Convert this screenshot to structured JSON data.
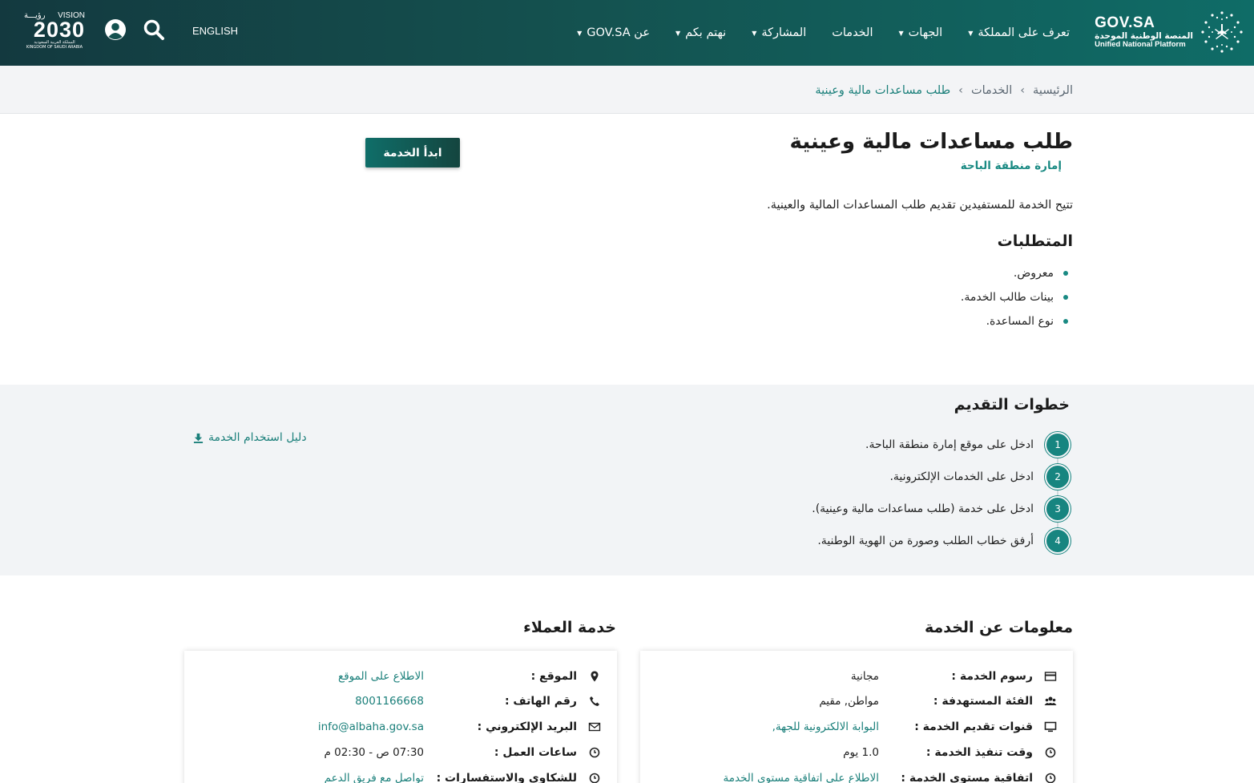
{
  "header": {
    "brand_title": "GOV.SA",
    "brand_ar": "المنصة الوطنية الموحدة",
    "brand_en": "Unified National Platform",
    "nav": [
      {
        "label": "تعرف على المملكة",
        "dropdown": true
      },
      {
        "label": "الجهات",
        "dropdown": true
      },
      {
        "label": "الخدمات",
        "dropdown": false
      },
      {
        "label": "المشاركة",
        "dropdown": true
      },
      {
        "label": "نهتم بكم",
        "dropdown": true
      },
      {
        "label": "عن GOV.SA",
        "dropdown": true
      }
    ],
    "language": "ENGLISH",
    "vision": {
      "en": "VISION",
      "ar": "رؤيـــة",
      "year": "2030",
      "sub_ar": "المملكة العربية السعودية",
      "sub_en": "KINGDOM OF SAUDI ARABIA"
    }
  },
  "breadcrumb": {
    "home": "الرئيسية",
    "services": "الخدمات",
    "current": "طلب مساعدات مالية وعينية"
  },
  "service": {
    "title": "طلب مساعدات مالية وعينية",
    "agency": "إمارة منطقة الباحة",
    "start_button": "ابدأ الخدمة",
    "description": "تتيح الخدمة للمستفيدين تقديم طلب المساعدات المالية والعينية.",
    "requirements_title": "المتطلبات",
    "requirements": [
      "معروض.",
      "بينات طالب الخدمة.",
      "نوع المساعدة."
    ]
  },
  "steps": {
    "title": "خطوات التقديم",
    "items": [
      {
        "num": "1",
        "text": "ادخل على موقع إمارة منطقة الباحة."
      },
      {
        "num": "2",
        "text": "ادخل على الخدمات الإلكترونية."
      },
      {
        "num": "3",
        "text": "ادخل على خدمة (طلب مساعدات مالية وعينية)."
      },
      {
        "num": "4",
        "text": "أرفق خطاب الطلب وصورة من الهوية الوطنية."
      }
    ],
    "guide_link": "دليل استخدام الخدمة"
  },
  "service_info": {
    "title": "معلومات عن الخدمة",
    "rows": [
      {
        "icon": "card-icon",
        "label": "رسوم الخدمة :",
        "value": "مجانية",
        "link": false
      },
      {
        "icon": "users-icon",
        "label": "الفئة المستهدفة :",
        "value": "مواطن, مقيم",
        "link": false
      },
      {
        "icon": "monitor-icon",
        "label": "قنوات تقديم الخدمة :",
        "value": "البوابة الالكترونية للجهة,",
        "link": true
      },
      {
        "icon": "clock-icon",
        "label": "وقت تنفيذ الخدمة :",
        "value": "1.0 يوم",
        "link": false
      },
      {
        "icon": "clock-icon",
        "label": "اتفاقية مستوى الخدمة :",
        "value": "الاطلاع على اتفاقية مستوى الخدمة",
        "link": true
      }
    ]
  },
  "customer_service": {
    "title": "خدمة العملاء",
    "rows": [
      {
        "icon": "location-icon",
        "label": "الموقع :",
        "value": "الاطلاع على الموقع",
        "link": true
      },
      {
        "icon": "phone-icon",
        "label": "رقم الهاتف :",
        "value": "8001166668",
        "link": true
      },
      {
        "icon": "mail-icon",
        "label": "البريد الإلكتروني :",
        "value": "info@albaha.gov.sa",
        "link": true
      },
      {
        "icon": "clock-icon",
        "label": "ساعات العمل :",
        "value": "07:30 ص - 02:30 م",
        "link": false
      },
      {
        "icon": "clock-icon",
        "label": "للشكاوى والاستفسارات :",
        "value": "تواصل مع فريق الدعم",
        "link": true
      }
    ]
  }
}
